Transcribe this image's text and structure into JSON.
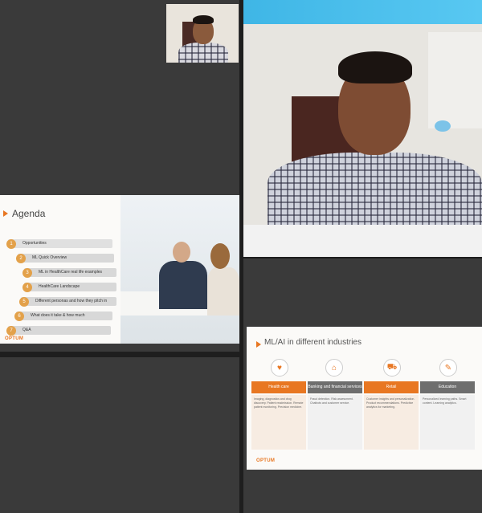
{
  "slide_agenda": {
    "title": "Agenda",
    "items": [
      {
        "num": "1",
        "label": "Opportunities"
      },
      {
        "num": "2",
        "label": "ML Quick Overview"
      },
      {
        "num": "3",
        "label": "ML in HealthCare real life examples"
      },
      {
        "num": "4",
        "label": "HealthCare Landscape"
      },
      {
        "num": "5",
        "label": "Different personas and how they pitch in"
      },
      {
        "num": "6",
        "label": "What does it take & how much"
      },
      {
        "num": "7",
        "label": "Q&A"
      }
    ],
    "logo": "OPTUM"
  },
  "slide_industries": {
    "title": "ML/AI in different industries",
    "columns": [
      {
        "icon": "heart-icon",
        "label": "Health care",
        "body": "Imaging, diagnostics and drug discovery. Patient readmission. Remote patient monitoring. Precision medicine."
      },
      {
        "icon": "bank-icon",
        "label": "Banking and financial services",
        "body": "Fraud detection. Risk assessment. Chatbots and customer service."
      },
      {
        "icon": "cart-icon",
        "label": "Retail",
        "body": "Customer insights and personalization. Product recommendations. Predictive analytics for marketing."
      },
      {
        "icon": "education-icon",
        "label": "Education",
        "body": "Personalized learning paths. Smart content. Learning analytics."
      }
    ],
    "logo": "OPTUM"
  },
  "colors": {
    "accent": "#e87722",
    "tile_dark": "#3a3a3a",
    "slide_bg": "#fbfaf8"
  }
}
